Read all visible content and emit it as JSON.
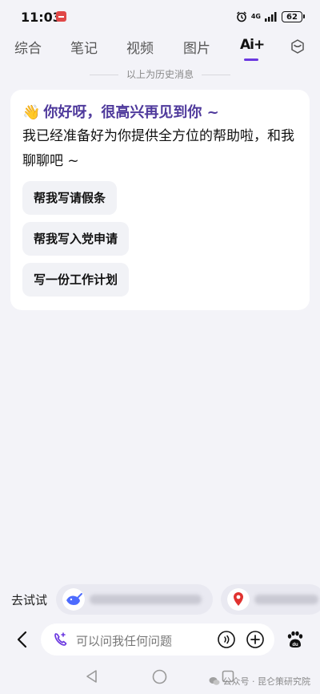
{
  "status_bar": {
    "time": "11:03",
    "network": "4G",
    "battery": "62"
  },
  "tabs": [
    {
      "label": "综合"
    },
    {
      "label": "笔记"
    },
    {
      "label": "视频"
    },
    {
      "label": "图片"
    }
  ],
  "ai_tab": {
    "label": "Ai+"
  },
  "history_label": "以上为历史消息",
  "greeting": {
    "emoji": "👋",
    "title": "你好呀，很高兴再见到你 ~",
    "intro": "我已经准备好为你提供全方位的帮助啦，和我聊聊吧 ~"
  },
  "suggestions": [
    {
      "label": "帮我写请假条"
    },
    {
      "label": "帮我写入党申请"
    },
    {
      "label": "写一份工作计划"
    }
  ],
  "try_row": {
    "label": "去试试"
  },
  "input": {
    "placeholder": "可以问我任何问题"
  },
  "watermark": "公众号 · 昆仑策研究院",
  "colors": {
    "accent": "#6b38e0",
    "greeting": "#4f3a9c",
    "background": "#f3f3f8"
  }
}
